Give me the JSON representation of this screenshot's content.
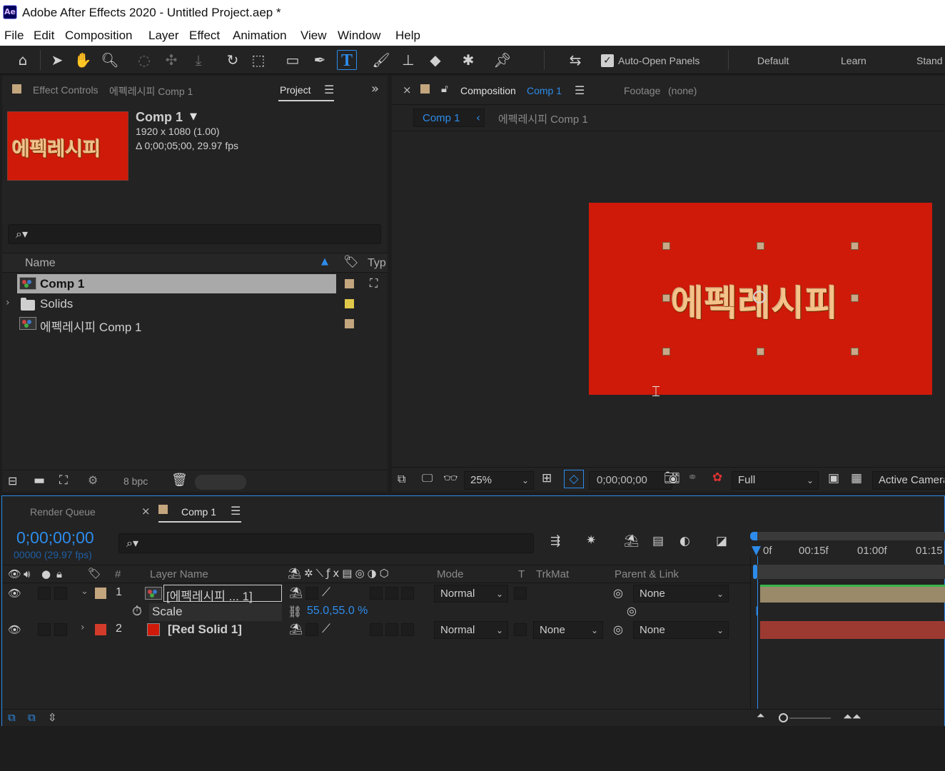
{
  "window": {
    "app_icon": "Ae",
    "title": "Adobe After Effects 2020 - Untitled Project.aep *"
  },
  "menu": [
    "File",
    "Edit",
    "Composition",
    "Layer",
    "Effect",
    "Animation",
    "View",
    "Window",
    "Help"
  ],
  "toolbar": {
    "auto_open_label": "Auto-Open Panels",
    "workspaces": [
      "Default",
      "Learn",
      "Stand"
    ]
  },
  "project_panel": {
    "tab_effect_controls": "Effect Controls",
    "tab_effect_controls_target": "에펙레시피 Comp 1",
    "tab_project": "Project",
    "thumb_text": "에펙레시피",
    "comp_name": "Comp 1",
    "comp_size": "1920 x 1080 (1.00)",
    "comp_duration": "Δ 0;00;05;00, 29.97 fps",
    "search_icon": "⌕▾",
    "col_name": "Name",
    "col_type": "Typ",
    "items": [
      {
        "name": "Comp 1",
        "color": "#c3a57e"
      },
      {
        "name": "Solids",
        "color": "#e1c84a"
      },
      {
        "name": "에펙레시피 Comp 1",
        "color": "#c3a57e"
      }
    ],
    "bpc": "8 bpc"
  },
  "comp_panel": {
    "tab_label": "Composition",
    "tab_comp": "Comp 1",
    "footage_tab": "Footage",
    "footage_value": "(none)",
    "breadcrumb_current": "Comp 1",
    "breadcrumb_next": "에펙레시피 Comp 1",
    "canvas_text": "에펙레시피",
    "zoom": "25%",
    "timecode": "0;00;00;00",
    "resolution": "Full",
    "camera": "Active Camera"
  },
  "timeline": {
    "tab_render_queue": "Render Queue",
    "tab_comp": "Comp 1",
    "timecode": "0;00;00;00",
    "frames": "00000 (29.97 fps)",
    "col_num": "#",
    "col_layer_name": "Layer Name",
    "col_mode": "Mode",
    "col_t": "T",
    "col_trkmat": "TrkMat",
    "col_parent": "Parent & Link",
    "ruler": [
      "0f",
      "00:15f",
      "01:00f",
      "01:15"
    ],
    "layers": [
      {
        "num": "1",
        "name": "[에펙레시피 ... 1]",
        "mode": "Normal",
        "trkmat": "",
        "parent": "None",
        "label_color": "#c3a57e",
        "icon": "comp"
      },
      {
        "num": "2",
        "name": "[Red Solid 1]",
        "mode": "Normal",
        "trkmat": "None",
        "parent": "None",
        "label_color": "#d23a2a",
        "icon": "solid"
      }
    ],
    "scale_label": "Scale",
    "scale_value": "55.0,55.0 %"
  }
}
